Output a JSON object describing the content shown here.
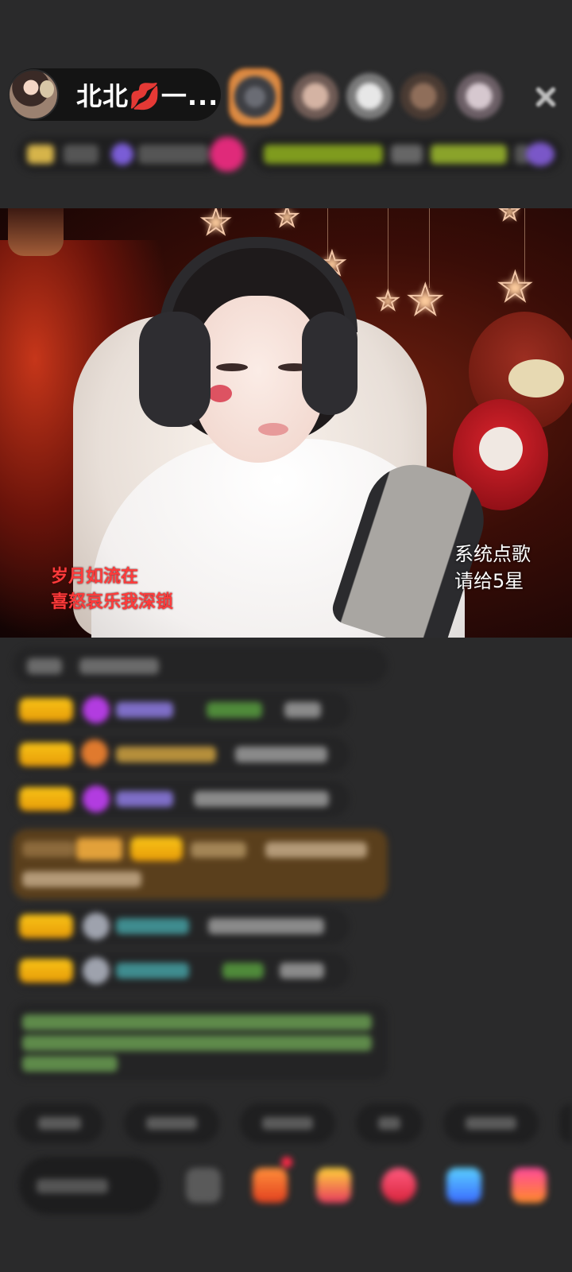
{
  "header": {
    "host_name": "北北💋一...",
    "close_icon": "close-icon"
  },
  "video": {
    "lyrics": {
      "line1": "岁月如流在",
      "line2": "喜怒哀乐我深锁"
    },
    "song_note": {
      "line1": "系统点歌",
      "line2": "请给5星"
    }
  },
  "colors": {
    "background": "#2a2a2b",
    "lyrics": "#ff3b3b",
    "badge_gold": "#f8c316",
    "avatar_ring": "#e5883a"
  }
}
